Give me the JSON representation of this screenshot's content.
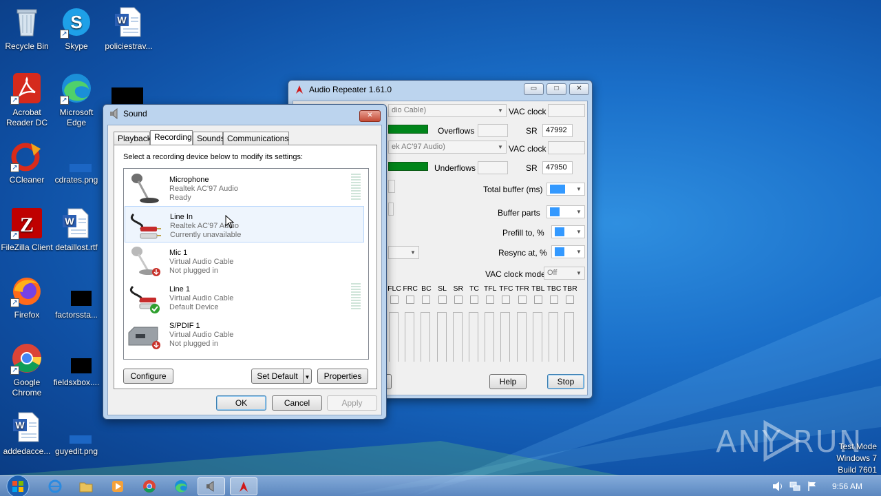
{
  "desktop": {
    "icons": [
      {
        "label": "Recycle Bin"
      },
      {
        "label": "Skype"
      },
      {
        "label": "policiestrav..."
      },
      {
        "label": "Acrobat Reader DC"
      },
      {
        "label": "Microsoft Edge"
      },
      {
        "label": "CCleaner"
      },
      {
        "label": "cdrates.png"
      },
      {
        "label": "FileZilla Client"
      },
      {
        "label": "detaillost.rtf"
      },
      {
        "label": "Firefox"
      },
      {
        "label": "factorssta..."
      },
      {
        "label": "Google Chrome"
      },
      {
        "label": "fieldsxbox...."
      },
      {
        "label": "addedacce..."
      },
      {
        "label": "guyedit.png"
      }
    ]
  },
  "audio_repeater": {
    "title": "Audio Repeater 1.61.0",
    "wave_in_value": "dio Cable)",
    "wave_out_value": "ek AC'97 Audio)",
    "vac_clock_label": "VAC clock",
    "overflows_label": "Overflows",
    "underflows_label": "Underflows",
    "sr_label": "SR",
    "sr_in_value": "47992",
    "sr_out_value": "47950",
    "total_buffer_label": "Total buffer (ms)",
    "buffer_parts_label": "Buffer parts",
    "prefill_label": "Prefill to, %",
    "resync_label": "Resync at, %",
    "vac_clock_mode_label": "VAC clock mode",
    "vac_clock_mode_value": "Off",
    "channels": [
      "FLC",
      "FRC",
      "BC",
      "SL",
      "SR",
      "TC",
      "TFL",
      "TFC",
      "TFR",
      "TBL",
      "TBC",
      "TBR"
    ],
    "help_label": "Help",
    "stop_label": "Stop"
  },
  "sound_dialog": {
    "title": "Sound",
    "tabs": [
      {
        "label": "Playback"
      },
      {
        "label": "Recording"
      },
      {
        "label": "Sounds"
      },
      {
        "label": "Communications"
      }
    ],
    "active_tab": "Recording",
    "instruction": "Select a recording device below to modify its settings:",
    "devices": [
      {
        "name": "Microphone",
        "driver": "Realtek AC'97 Audio",
        "status": "Ready"
      },
      {
        "name": "Line In",
        "driver": "Realtek AC'97 Audio",
        "status": "Currently unavailable"
      },
      {
        "name": "Mic 1",
        "driver": "Virtual Audio Cable",
        "status": "Not plugged in"
      },
      {
        "name": "Line 1",
        "driver": "Virtual Audio Cable",
        "status": "Default Device"
      },
      {
        "name": "S/PDIF 1",
        "driver": "Virtual Audio Cable",
        "status": "Not plugged in"
      }
    ],
    "configure_label": "Configure",
    "set_default_label": "Set Default",
    "properties_label": "Properties",
    "ok_label": "OK",
    "cancel_label": "Cancel",
    "apply_label": "Apply"
  },
  "watermark": {
    "brand": "ANY RUN",
    "line1": "Test Mode",
    "line2": "Windows 7",
    "line3": "Build 7601"
  },
  "taskbar": {
    "clock": "9:56 AM"
  }
}
